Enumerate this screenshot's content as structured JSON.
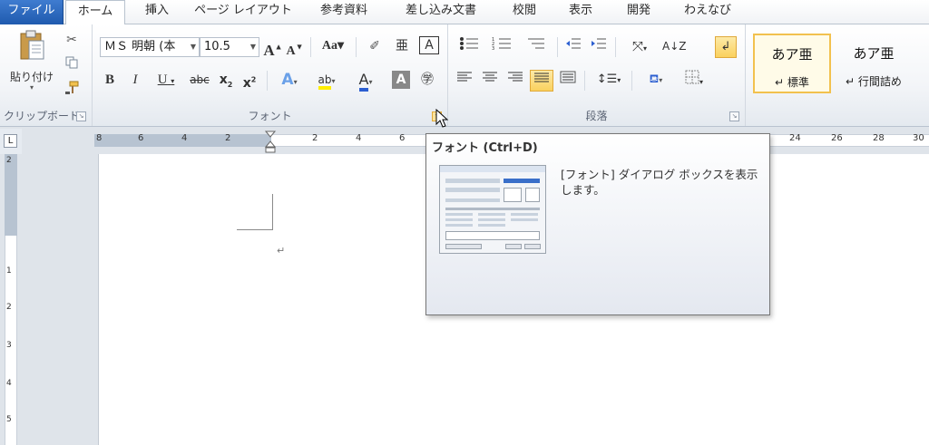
{
  "tabs": [
    "ファイル",
    "ホーム",
    "挿入",
    "ページ レイアウト",
    "参考資料",
    "差し込み文書",
    "校閲",
    "表示",
    "開発",
    "わえなび"
  ],
  "clipboard": {
    "paste_label": "貼り付け",
    "group_label": "クリップボード"
  },
  "font": {
    "name": "ＭＳ 明朝 (本",
    "size": "10.5",
    "group_label": "フォント"
  },
  "paragraph": {
    "group_label": "段落"
  },
  "styles": {
    "items": [
      {
        "sample": "あア亜",
        "name": "標準"
      },
      {
        "sample": "あア亜",
        "name": "行間詰め"
      }
    ]
  },
  "ruler": {
    "h_left": [
      "8",
      "6",
      "4",
      "2"
    ],
    "h_right": [
      "2",
      "4",
      "6"
    ],
    "h_far": [
      "24",
      "26",
      "28",
      "30"
    ],
    "v": [
      "2",
      "1",
      "2",
      "3",
      "4",
      "5"
    ]
  },
  "document": {
    "para_mark": "↵"
  },
  "tooltip": {
    "title": "フォント (Ctrl+D)",
    "description": "[フォント] ダイアログ ボックスを表示します。"
  },
  "icons": {
    "tabstop": "L",
    "launcher": "↘"
  }
}
